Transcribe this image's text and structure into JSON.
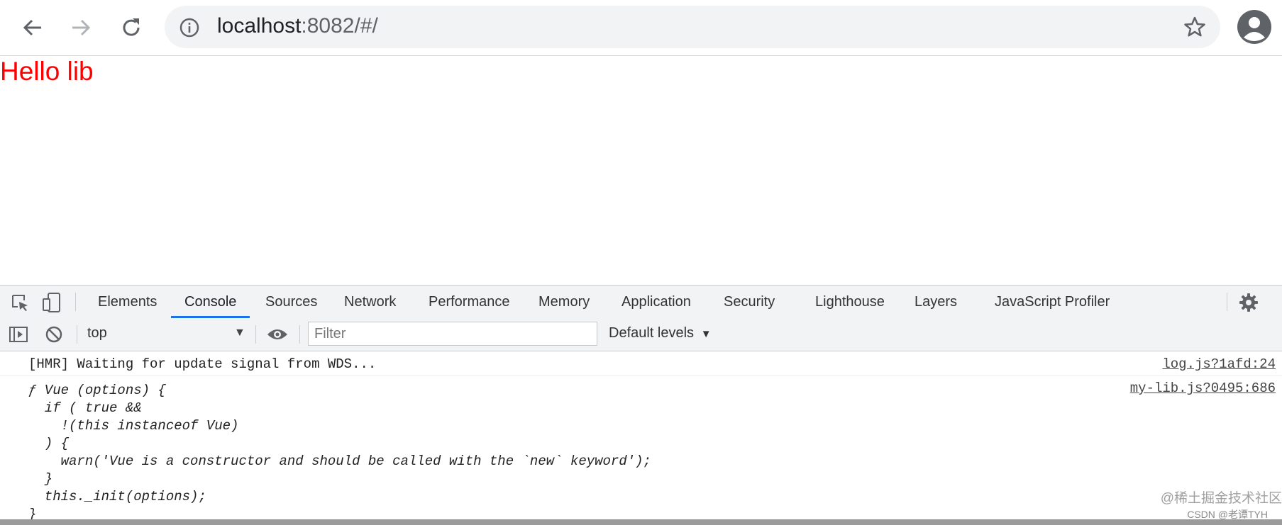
{
  "browser": {
    "url_host": "localhost",
    "url_rest": ":8082/#/"
  },
  "page": {
    "heading": "Hello lib"
  },
  "devtools": {
    "tabs": [
      {
        "label": "Elements"
      },
      {
        "label": "Console",
        "active": true
      },
      {
        "label": "Sources"
      },
      {
        "label": "Network"
      },
      {
        "label": "Performance"
      },
      {
        "label": "Memory"
      },
      {
        "label": "Application"
      },
      {
        "label": "Security"
      },
      {
        "label": "Lighthouse"
      },
      {
        "label": "Layers"
      },
      {
        "label": "JavaScript Profiler"
      }
    ],
    "console_bar": {
      "context": "top",
      "filter_placeholder": "Filter",
      "levels": "Default levels"
    },
    "logs": [
      {
        "message": "[HMR] Waiting for update signal from WDS...",
        "source": "log.js?1afd:24"
      },
      {
        "source": "my-lib.js?0495:686",
        "code_lines": [
          "ƒ Vue (options) {",
          "  if ( true &&",
          "    !(this instanceof Vue)",
          "  ) {",
          "    warn('Vue is a constructor and should be called with the `new` keyword');",
          "  }",
          "  this._init(options);",
          "}"
        ]
      }
    ]
  },
  "watermark": {
    "line1": "@稀土掘金技术社区",
    "line2": "CSDN @老谭TYH"
  },
  "colors": {
    "heading": "#ff0000",
    "active_tab_underline": "#1a73e8"
  }
}
